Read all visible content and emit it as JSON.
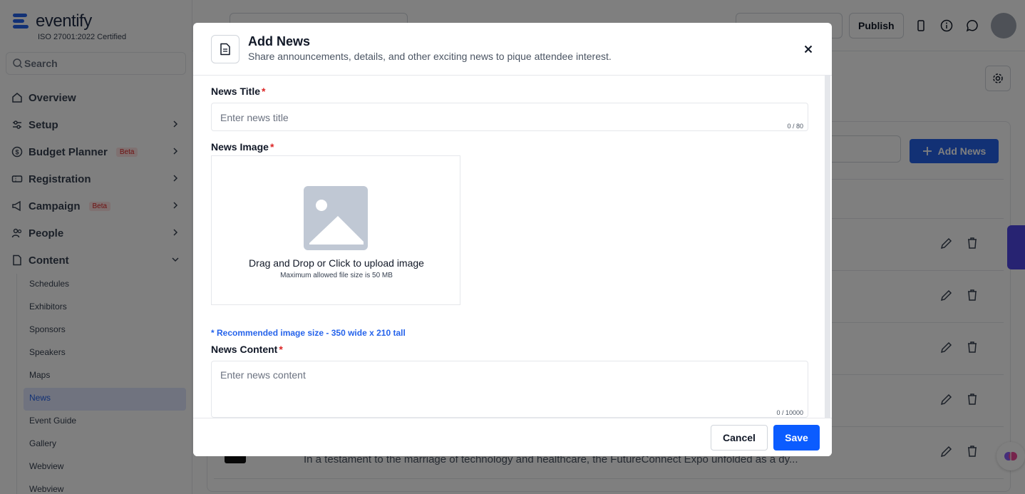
{
  "sidebar": {
    "logo_text": "eventify",
    "certification": "ISO 27001:2022 Certified",
    "search_placeholder": "Search",
    "items": [
      {
        "label": "Overview"
      },
      {
        "label": "Setup"
      },
      {
        "label": "Budget Planner",
        "badge": "Beta"
      },
      {
        "label": "Registration"
      },
      {
        "label": "Campaign",
        "badge": "Beta"
      },
      {
        "label": "People"
      },
      {
        "label": "Content"
      }
    ],
    "content_subitems": [
      "Schedules",
      "Exhibitors",
      "Sponsors",
      "Speakers",
      "Maps",
      "News",
      "Event Guide",
      "Gallery",
      "Webview",
      "Webview"
    ],
    "active_subitem": "News"
  },
  "topbar": {
    "publish_label": "Publish"
  },
  "main": {
    "add_news_label": "Add News",
    "row_preview_text": "In a testament to the marriage of technology and healthcare, the FutureConnect Expo unfolded as a dy..."
  },
  "modal": {
    "title": "Add News",
    "subtitle": "Share announcements, details, and other exciting news to pique attendee interest.",
    "news_title_label": "News Title",
    "required_mark": "*",
    "news_title_placeholder": "Enter news title",
    "news_title_counter": "0 / 80",
    "news_image_label": "News Image",
    "upload_main_text": "Drag and Drop or Click to upload image",
    "upload_sub_text": "Maximum allowed file size is 50 MB",
    "recommended_text": "* Recommended image size - 350 wide x 210 tall",
    "news_content_label": "News Content",
    "news_content_placeholder": "Enter news content",
    "news_content_counter": "0 / 10000",
    "cancel_label": "Cancel",
    "save_label": "Save"
  },
  "colors": {
    "primary": "#0b5cff",
    "required": "#dc2626",
    "overlay": "rgba(0,0,0,0.5)"
  }
}
